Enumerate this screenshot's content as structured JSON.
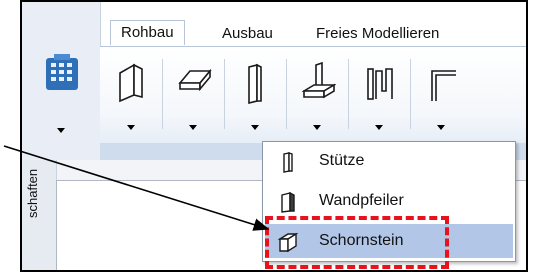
{
  "tabs": [
    {
      "label": "Rohbau",
      "active": true
    },
    {
      "label": "Ausbau",
      "active": false
    },
    {
      "label": "Freies Modellieren",
      "active": false
    }
  ],
  "ribbon_buttons": [
    {
      "icon": "wall-icon"
    },
    {
      "icon": "slab-icon"
    },
    {
      "icon": "column-icon"
    },
    {
      "icon": "foundation-icon"
    },
    {
      "icon": "beam-icon"
    },
    {
      "icon": "frame-icon"
    }
  ],
  "dropdown_menu": {
    "items": [
      {
        "label": "Stütze",
        "icon": "column-icon",
        "highlighted": false
      },
      {
        "label": "Wandpfeiler",
        "icon": "pilaster-icon",
        "highlighted": false
      },
      {
        "label": "Schornstein",
        "icon": "chimney-icon",
        "highlighted": true
      }
    ]
  },
  "side_panel": {
    "label": "schaften"
  },
  "colors": {
    "annotation_box": "#e8121c",
    "menu_highlight": "#b2c7e8",
    "ribbon_bg": "#f4f7fb"
  }
}
